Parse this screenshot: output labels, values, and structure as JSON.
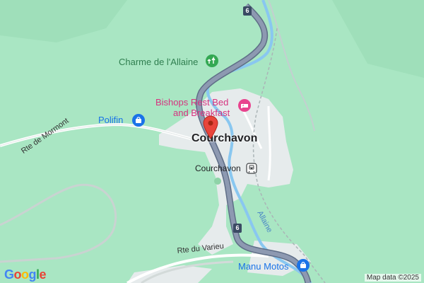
{
  "map": {
    "pois": {
      "park": "Charme de l'Allaine",
      "lodging_line1": "Bishops Rest Bed",
      "lodging_line2": "and Breakfast",
      "shop1": "Polifin",
      "shop2": "Manu Motos"
    },
    "town": "Courchavon",
    "station": "Courchavon",
    "roads": {
      "mormont": "Rte de Mormont",
      "varieu": "Rte du Varieu",
      "route_number": "6"
    },
    "river": "Allaine",
    "icons": [
      "park-icon",
      "hotel-icon",
      "shopping-icon",
      "train-icon",
      "location-pin-icon"
    ],
    "colors": {
      "background": "#a9e6c3",
      "urban": "#e6ebec",
      "highway": "#8d99b1",
      "water": "#89c7f0",
      "pin": "#e8453c"
    }
  },
  "footer": {
    "logo": "Google",
    "attribution": "Map data ©2025"
  }
}
